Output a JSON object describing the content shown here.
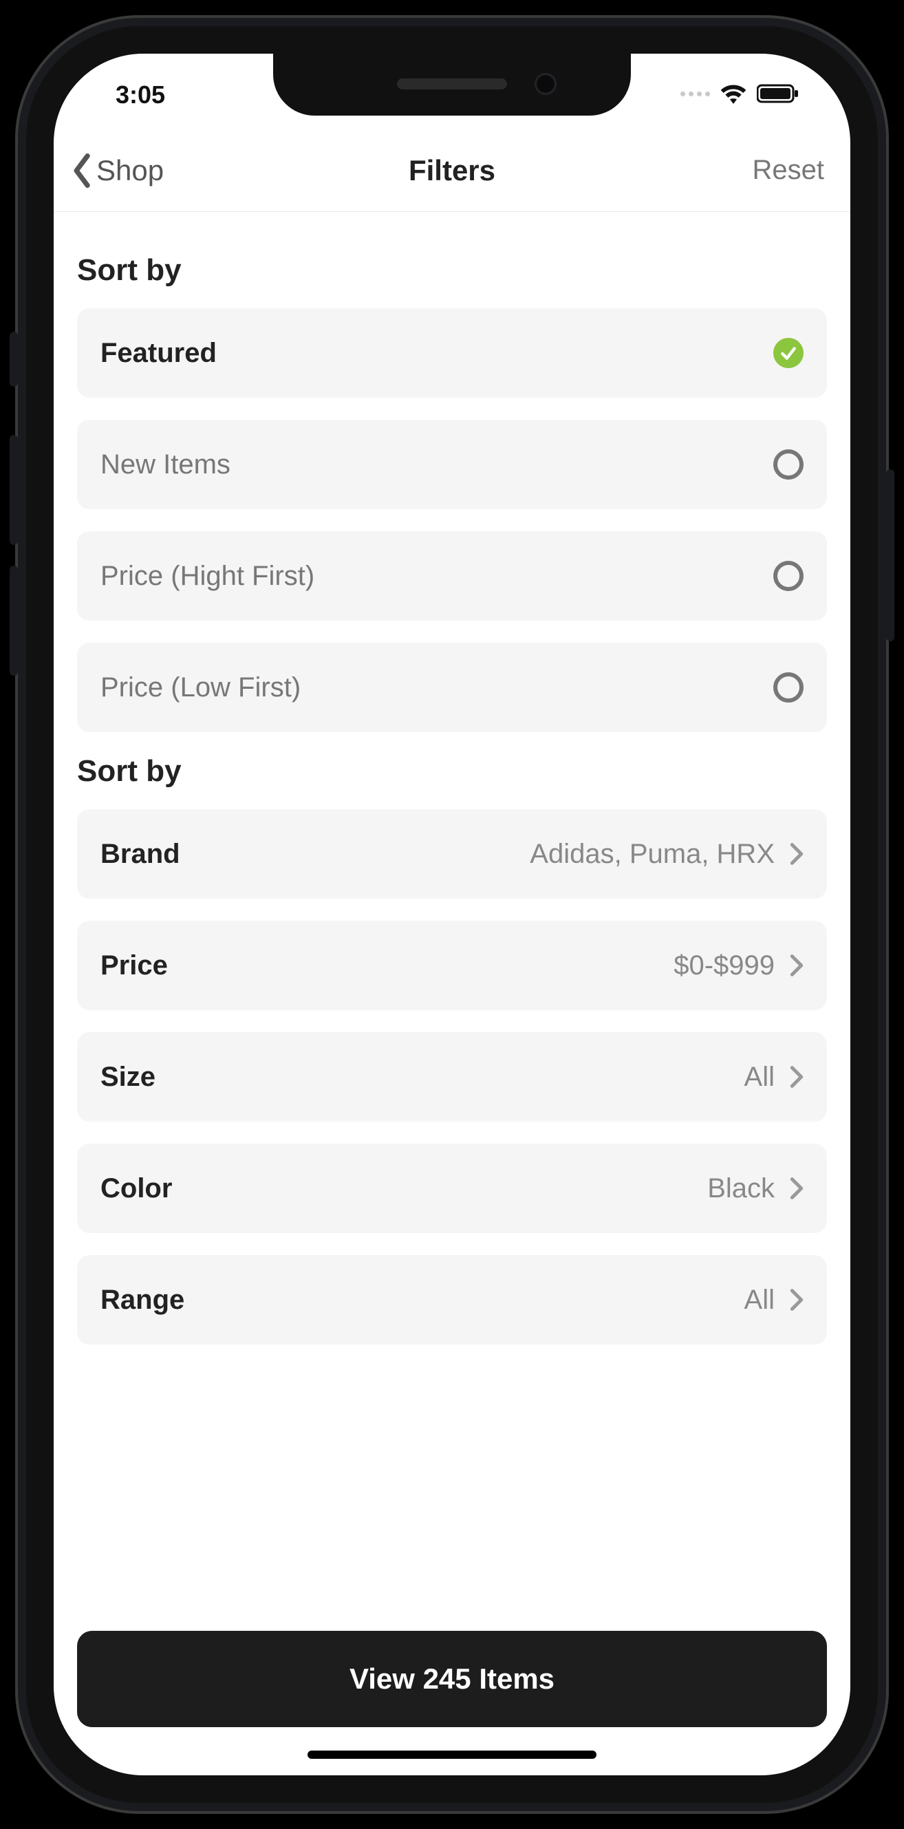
{
  "status": {
    "time": "3:05"
  },
  "nav": {
    "back_label": "Shop",
    "title": "Filters",
    "reset": "Reset"
  },
  "section1": {
    "title": "Sort by",
    "options": [
      "Featured",
      "New Items",
      "Price (Hight First)",
      "Price (Low First)"
    ],
    "selected_index": 0
  },
  "section2": {
    "title": "Sort by",
    "rows": [
      {
        "label": "Brand",
        "value": "Adidas, Puma, HRX"
      },
      {
        "label": "Price",
        "value": "$0-$999"
      },
      {
        "label": "Size",
        "value": "All"
      },
      {
        "label": "Color",
        "value": "Black"
      },
      {
        "label": "Range",
        "value": "All"
      }
    ]
  },
  "cta": {
    "label": "View 245 Items"
  }
}
